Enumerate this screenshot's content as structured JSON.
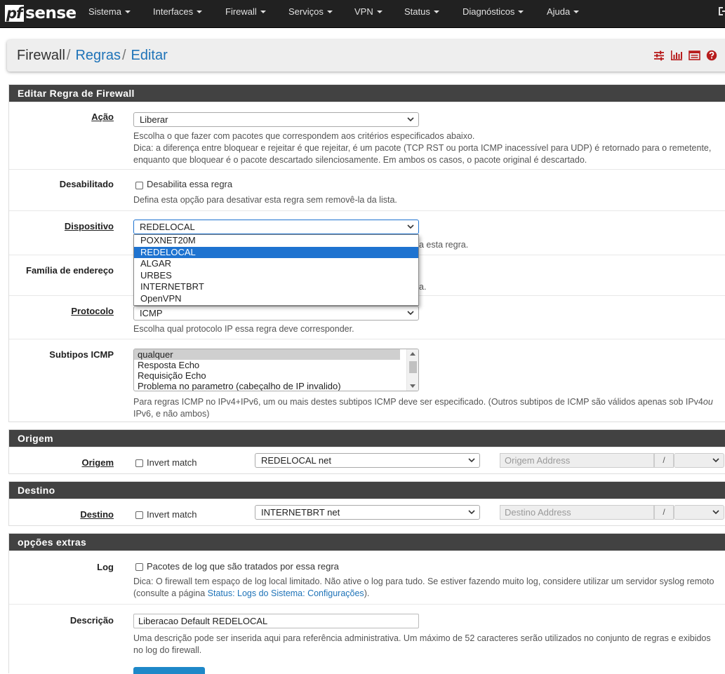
{
  "navbar": {
    "logo_pf": "pf",
    "logo_sense": "sense",
    "items": [
      {
        "label": "Sistema"
      },
      {
        "label": "Interfaces"
      },
      {
        "label": "Firewall"
      },
      {
        "label": "Serviços"
      },
      {
        "label": "VPN"
      },
      {
        "label": "Status"
      },
      {
        "label": "Diagnósticos"
      },
      {
        "label": "Ajuda"
      }
    ],
    "logout_icon": "sign-out-icon"
  },
  "breadcrumb": {
    "root": "Firewall",
    "sep": "/",
    "level1": "Regras",
    "level2": "Editar",
    "icons": [
      "sliders-icon",
      "bar-chart-icon",
      "list-icon",
      "help-circle-icon"
    ],
    "icon_color": "#b71c1c"
  },
  "panel_rule": {
    "heading": "Editar Regra de Firewall",
    "acao": {
      "label": "Ação",
      "value": "Liberar",
      "help1": "Escolha o que fazer com pacotes que correspondem aos critérios especificados abaixo.",
      "help2": "Dica: a diferença entre bloquear e rejeitar é que rejeitar, é um pacote (TCP RST ou porta ICMP inacessível para UDP) é retornado para o remetente,",
      "help3": "enquanto que bloquear é o pacote descartado silenciosamente. Em ambos os casos, o pacote original é descartado."
    },
    "desabilitado": {
      "label": "Desabilitado",
      "checkbox_label": "Desabilita essa regra",
      "help": "Defina esta opção para desativar esta regra sem removê-la da lista."
    },
    "dispositivo": {
      "label": "Dispositivo",
      "value": "REDELOCAL",
      "help_tail": "a esta regra.",
      "options": [
        "POXNET20M",
        "REDELOCAL",
        "ALGAR",
        "URBES",
        "INTERNETBRT",
        "OpenVPN"
      ],
      "highlighted_index": 1
    },
    "familia": {
      "label": "Família de endereço",
      "help_tail": "a."
    },
    "protocolo": {
      "label": "Protocolo",
      "value": "ICMP",
      "help": "Escolha qual protocolo IP essa regra deve corresponder."
    },
    "subtipos": {
      "label": "Subtipos ICMP",
      "options": [
        "qualquer",
        "Resposta Echo",
        "Requisição Echo",
        "Problema no parametro (cabeçalho de IP invalido)"
      ],
      "selected_index": 0,
      "help1_a": "Para regras ICMP no IPv4+IPv6, um ou mais destes subtipos ICMP deve ser especificado. (Outros subtipos de ICMP são válidos apenas sob IPv4",
      "help1_b": "ou",
      "help2": "IPv6, e não ambos)"
    }
  },
  "panel_origem": {
    "heading": "Origem",
    "label": "Origem",
    "invert_label": "Invert match",
    "net_value": "REDELOCAL net",
    "address_placeholder": "Origem Address",
    "slash": "/"
  },
  "panel_destino": {
    "heading": "Destino",
    "label": "Destino",
    "invert_label": "Invert match",
    "net_value": "INTERNETBRT net",
    "address_placeholder": "Destino Address",
    "slash": "/"
  },
  "panel_extras": {
    "heading": "opções extras",
    "log": {
      "label": "Log",
      "checkbox_label": "Pacotes de log que são tratados por essa regra",
      "help1": "Dica: O firewall tem espaço de log local limitado. Não ative o log para tudo. Se estiver fazendo muito log, considere utilizar um servidor syslog remoto",
      "help2_a": "(consulte a página ",
      "help2_link": "Status: Logs do Sistema: Configurações",
      "help2_b": ")."
    },
    "descricao": {
      "label": "Descrição",
      "value": "Liberacao Default REDELOCAL",
      "help1": "Uma descrição pode ser inserida aqui para referência administrativa. Um máximo de 52 caracteres serão utilizados no conjunto de regras e exibidos",
      "help2": "no log do firewall."
    }
  }
}
